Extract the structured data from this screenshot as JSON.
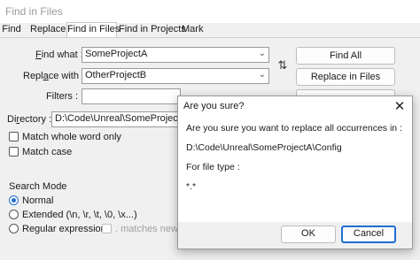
{
  "window": {
    "title": "Find in Files"
  },
  "tabs": [
    {
      "label": "Find"
    },
    {
      "label": "Replace"
    },
    {
      "label": "Find in Files"
    },
    {
      "label": "Find in Projects"
    },
    {
      "label": "Mark"
    }
  ],
  "form": {
    "find_what_label_a": "F",
    "find_what_label_b": "ind what :",
    "find_what_value": "SomeProjectA",
    "replace_with_label_a": "Repl",
    "replace_with_label_b": "a",
    "replace_with_label_c": "ce with :",
    "replace_with_value": "OtherProjectB",
    "filters_label": "Filters :",
    "filters_value": "",
    "directory_label_a": "Di",
    "directory_label_b": "r",
    "directory_label_c": "ectory :",
    "directory_value": "D:\\Code\\Unreal\\SomeProjectA\\Cor",
    "swap_icon": "swap-arrows-icon"
  },
  "buttons": {
    "find_all": "Find All",
    "replace_in_files": "Replace in Files"
  },
  "options": {
    "match_whole_word": "Match whole word only",
    "match_case": "Match case",
    "search_mode_label": "Search Mode",
    "normal": "Normal",
    "extended": "Extended (\\n, \\r, \\t, \\0, \\x...)",
    "regex": "Regular expression",
    "matches_newline": ". matches newline"
  },
  "dialog": {
    "title": "Are you sure?",
    "line1": "Are you sure you want to replace all occurrences in :",
    "line2": "D:\\Code\\Unreal\\SomeProjectA\\Config",
    "line3": "For file type :",
    "line4": "*.*",
    "ok": "OK",
    "cancel": "Cancel",
    "close_icon": "close-icon"
  },
  "colors": {
    "accent": "#1f6fd0",
    "background": "#f0f0f0",
    "white": "#ffffff"
  }
}
